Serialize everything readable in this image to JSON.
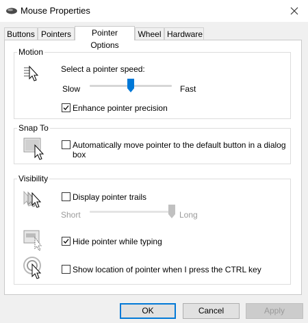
{
  "window": {
    "title": "Mouse Properties"
  },
  "tabs": [
    {
      "label": "Buttons"
    },
    {
      "label": "Pointers"
    },
    {
      "label": "Pointer Options"
    },
    {
      "label": "Wheel"
    },
    {
      "label": "Hardware"
    }
  ],
  "motion": {
    "group_label": "Motion",
    "speed_label": "Select a pointer speed:",
    "slow_label": "Slow",
    "fast_label": "Fast",
    "speed_value_fraction": 0.5,
    "precision_label": "Enhance pointer precision",
    "precision_checked": true
  },
  "snap_to": {
    "group_label": "Snap To",
    "snap_label_line1": "Automatically move pointer to the default button in a dialog",
    "snap_label_line2": "box",
    "snap_checked": false
  },
  "visibility": {
    "group_label": "Visibility",
    "trails_label": "Display pointer trails",
    "trails_checked": false,
    "short_label": "Short",
    "long_label": "Long",
    "trails_value_fraction": 1.0,
    "hide_label": "Hide pointer while typing",
    "hide_checked": true,
    "ctrl_label": "Show location of pointer when I press the CTRL key",
    "ctrl_checked": false
  },
  "buttons": {
    "ok": "OK",
    "cancel": "Cancel",
    "apply": "Apply"
  },
  "colors": {
    "accent": "#0078d7",
    "slider_thumb": "#0078d7",
    "disabled": "#c0c0c0"
  }
}
